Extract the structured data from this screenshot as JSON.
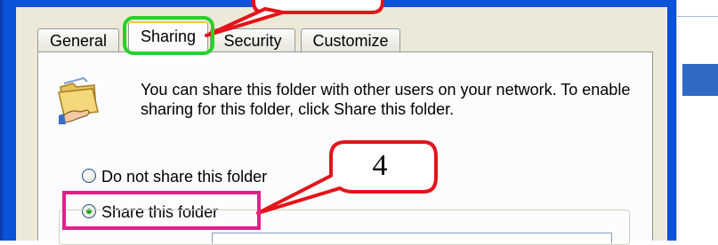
{
  "tabs": [
    {
      "label": "General",
      "active": false
    },
    {
      "label": "Sharing",
      "active": true
    },
    {
      "label": "Security",
      "active": false
    },
    {
      "label": "Customize",
      "active": false
    }
  ],
  "sharing": {
    "info_text": "You can share this folder with other users on your network.  To enable sharing for this folder, click Share this folder.",
    "options": [
      {
        "label": "Do not share this folder",
        "selected": false
      },
      {
        "label": "Share this folder",
        "selected": true
      }
    ]
  },
  "annotations": {
    "callout_top": "",
    "callout_step": "4",
    "highlight_tab_color": "#27d12a",
    "highlight_option_color": "#e0218a",
    "callout_border_color": "#e3141b"
  },
  "icons": {
    "folder": "shared-folder-icon"
  },
  "colors": {
    "window_frame": "#0a52d6",
    "dialog_bg": "#ece9d8",
    "selection": "#316ac5"
  }
}
